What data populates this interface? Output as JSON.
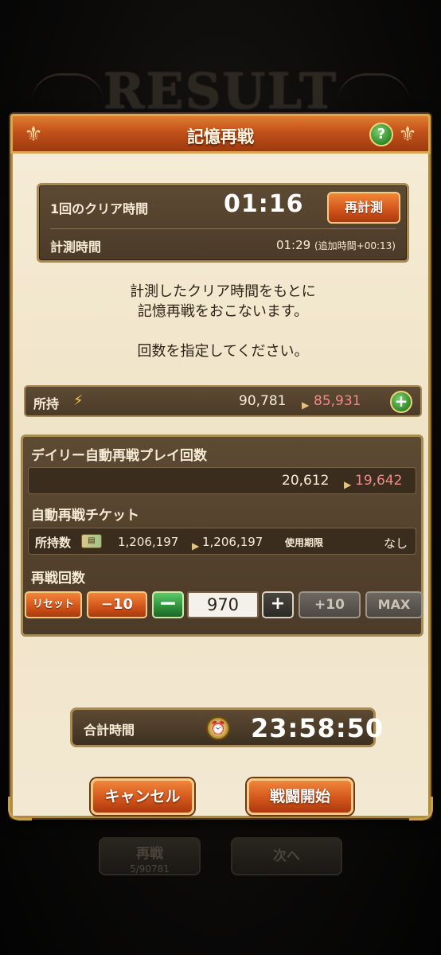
{
  "background": {
    "title": "RESULT",
    "retry_label": "再戦",
    "retry_sub": "5/90781",
    "next_label": "次へ"
  },
  "modal": {
    "title": "記憶再戦",
    "help": "?"
  },
  "measure": {
    "clear_time_label": "1回のクリア時間",
    "clear_time": "01:16",
    "remeasure_label": "再計測",
    "measure_time_label": "計測時間",
    "measure_time": "01:29",
    "extra_time": "(追加時間+00:13)"
  },
  "description": {
    "line1": "計測したクリア時間をもとに",
    "line2": "記憶再戦をおこないます。",
    "line3": "回数を指定してください。"
  },
  "owned": {
    "label": "所持",
    "current": "90,781",
    "after": "85,931",
    "plus": "+"
  },
  "daily": {
    "label": "デイリー自動再戦プレイ回数",
    "current": "20,612",
    "after": "19,642"
  },
  "ticket": {
    "section_label": "自動再戦チケット",
    "owned_label": "所持数",
    "current": "1,206,197",
    "after": "1,206,197",
    "expiry_label": "使用期限",
    "expiry_value": "なし"
  },
  "count": {
    "section_label": "再戦回数",
    "reset_label": "リセット",
    "minus10_label": "−10",
    "minus_label": "−",
    "value": "970",
    "plus_label": "+",
    "plus10_label": "+10",
    "max_label": "MAX"
  },
  "total": {
    "label": "合計時間",
    "time": "23:58:50"
  },
  "actions": {
    "cancel_label": "キャンセル",
    "start_label": "戦闘開始"
  },
  "colors": {
    "accent_orange": "#d0531a",
    "panel_brown": "#5d4a33",
    "after_value_red": "#f08a8a",
    "modal_bg": "#f6edd7"
  },
  "icons": {
    "stamina": "bolt-icon",
    "ticket": "ticket-icon",
    "clock": "alarm-clock-icon",
    "help": "question-icon",
    "add": "plus-icon"
  }
}
